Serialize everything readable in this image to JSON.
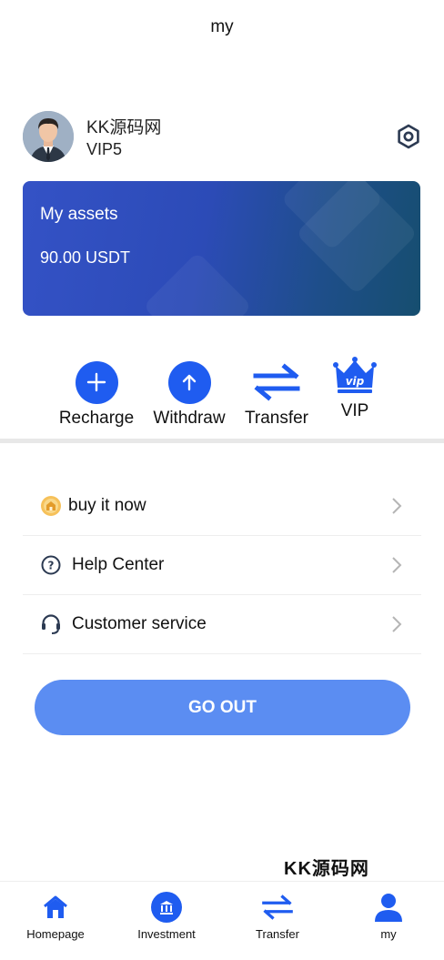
{
  "header": {
    "title": "my"
  },
  "profile": {
    "name": "KK源码网",
    "level": "VIP5"
  },
  "assets": {
    "title": "My assets",
    "value": "90.00 USDT"
  },
  "actions": [
    {
      "label": "Recharge",
      "icon": "plus-icon"
    },
    {
      "label": "Withdraw",
      "icon": "arrow-up-icon"
    },
    {
      "label": "Transfer",
      "icon": "transfer-icon"
    },
    {
      "label": "VIP",
      "icon": "vip-crown-icon"
    }
  ],
  "menu": [
    {
      "label": "buy it now",
      "icon": "shop-icon"
    },
    {
      "label": "Help Center",
      "icon": "question-icon"
    },
    {
      "label": "Customer service",
      "icon": "headset-icon"
    }
  ],
  "logout": {
    "label": "GO OUT"
  },
  "watermark": "KK源码网",
  "tabbar": [
    {
      "label": "Homepage",
      "icon": "home-icon"
    },
    {
      "label": "Investment",
      "icon": "bank-icon"
    },
    {
      "label": "Transfer",
      "icon": "transfer-icon"
    },
    {
      "label": "my",
      "icon": "user-icon"
    }
  ],
  "colors": {
    "accent": "#1f5cf0",
    "button": "#5b8df2",
    "card_start": "#3452c6",
    "card_end": "#164e6f"
  }
}
